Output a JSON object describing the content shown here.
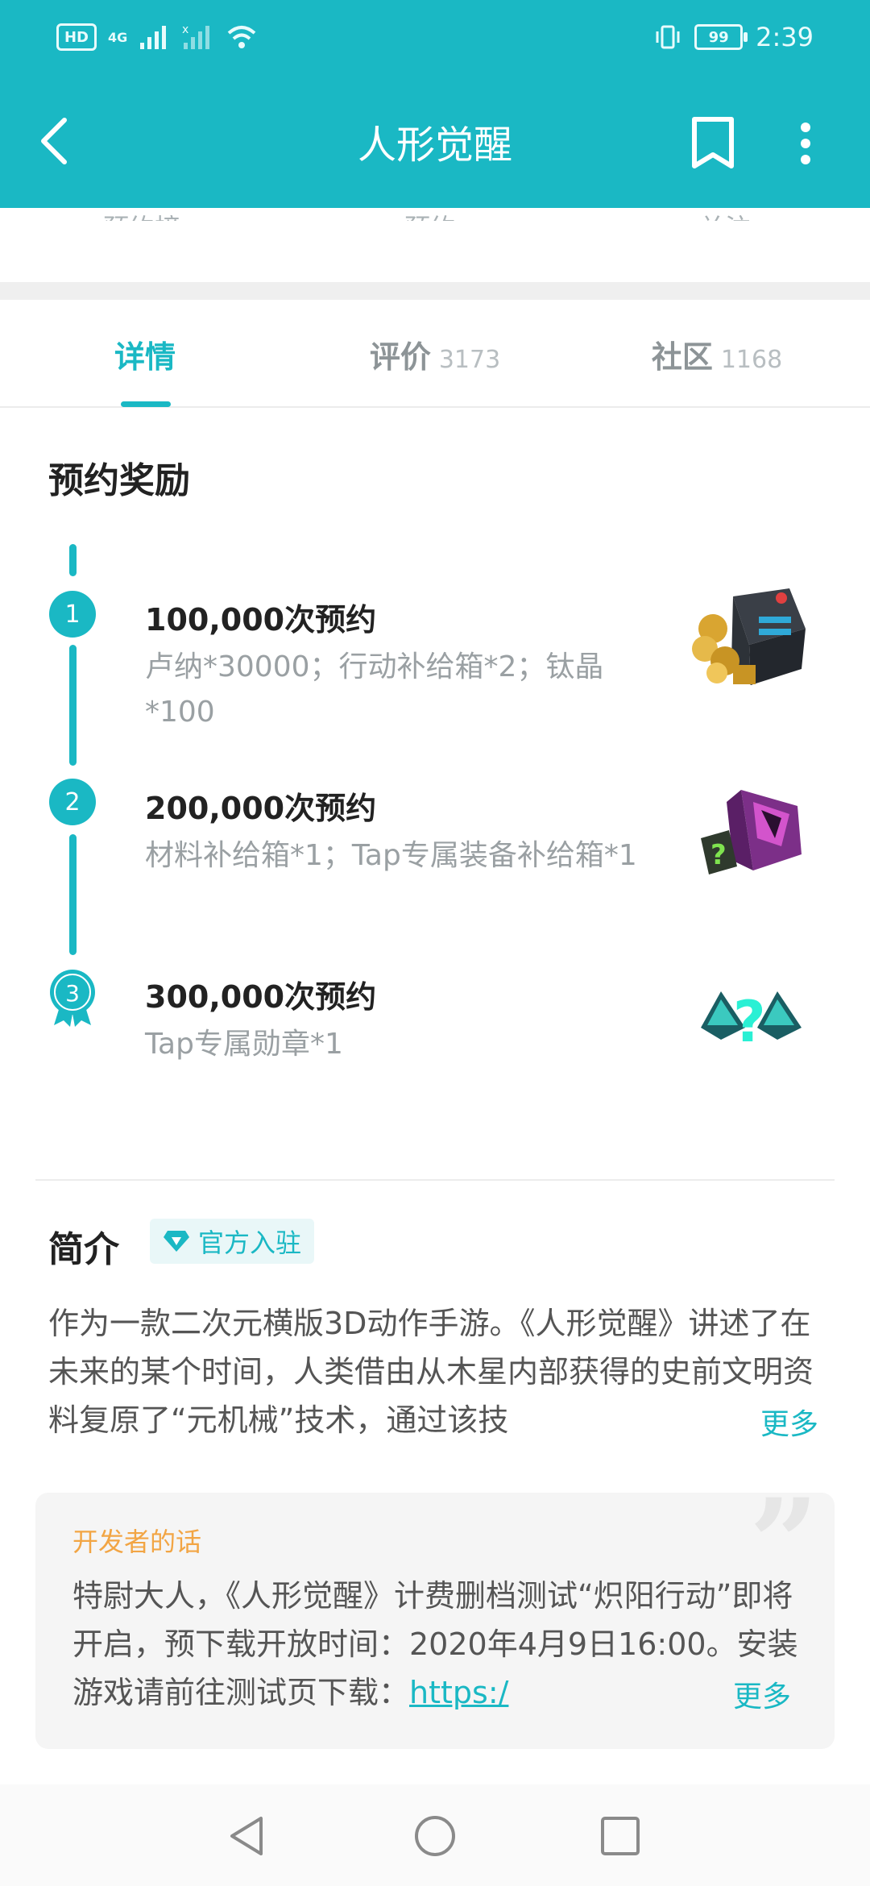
{
  "status_bar": {
    "hd": "HD",
    "network": "4G",
    "battery": "99",
    "time": "2:39"
  },
  "header": {
    "title": "人形觉醒",
    "icons": [
      "back-arrow-icon",
      "bookmark-icon",
      "more-vertical-icon"
    ]
  },
  "stats_row": {
    "labels": [
      "预约榜",
      "预约",
      "关注"
    ]
  },
  "tabs": [
    {
      "label": "详情",
      "count": ""
    },
    {
      "label": "评价",
      "count": "3173"
    },
    {
      "label": "社区",
      "count": "1168"
    }
  ],
  "rewards": {
    "title": "预约奖励",
    "items": [
      {
        "step": "1",
        "title": "100,000次预约",
        "desc": "卢纳*30000；行动补给箱*2；钛晶*100",
        "icon": "supply-box-icon"
      },
      {
        "step": "2",
        "title": "200,000次预约",
        "desc": "材料补给箱*1；Tap专属装备补给箱*1",
        "icon": "mystery-crate-icon"
      },
      {
        "step": "3",
        "title": "300,000次预约",
        "desc": "Tap专属勋章*1",
        "icon": "mystery-medal-icon"
      }
    ]
  },
  "intro": {
    "title": "简介",
    "badge": "官方入驻",
    "text": "作为一款二次元横版3D动作手游。《人形觉醒》讲述了在未来的某个时间，人类借由从木星内部获得的史前文明资料复原了“元机械”技术，通过该技",
    "more": "更多"
  },
  "developer_note": {
    "title": "开发者的话",
    "text": "特尉大人，《人形觉醒》计费删档测试“炽阳行动”即将开启，预下载开放时间：2020年4月9日16:00。安装游戏请前往测试页下载：",
    "link": "https:/",
    "more": "更多"
  },
  "colors": {
    "accent": "#1ab8c4",
    "dev_title": "#f2a544"
  }
}
